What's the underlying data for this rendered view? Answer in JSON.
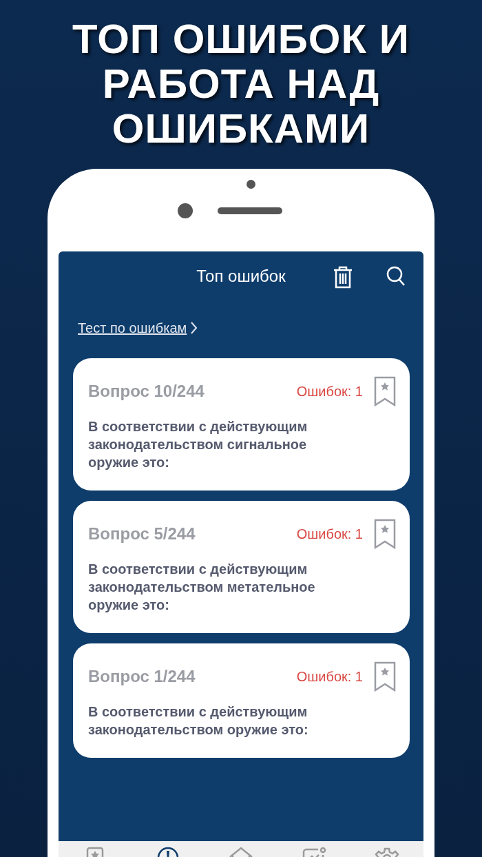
{
  "headline": [
    "ТОП ОШИБОК И",
    "РАБОТА НАД",
    "ОШИБКАМИ"
  ],
  "screen": {
    "title": "Топ ошибок",
    "test_link": "Тест по ошибкам",
    "questions": [
      {
        "number": "Вопрос 10/244",
        "errors": "Ошибок: 1",
        "text": "В соответствии с действующим законодательством сигнальное оружие это:"
      },
      {
        "number": "Вопрос 5/244",
        "errors": "Ошибок: 1",
        "text": "В соответствии с действующим законодательством метательное оружие это:"
      },
      {
        "number": "Вопрос 1/244",
        "errors": "Ошибок: 1",
        "text": "В соответствии с действующим законодательством оружие это:"
      }
    ],
    "tab_bar": [
      {
        "selected": false
      },
      {
        "selected": true
      },
      {
        "selected": false
      },
      {
        "selected": false
      },
      {
        "selected": false
      }
    ]
  }
}
